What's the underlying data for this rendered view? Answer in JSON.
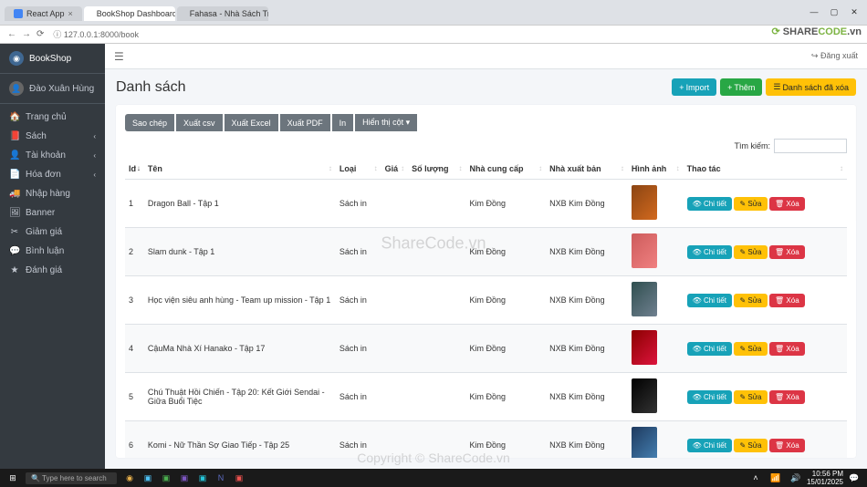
{
  "browser": {
    "tabs": [
      {
        "title": "React App",
        "active": false
      },
      {
        "title": "BookShop Dashboard",
        "active": true
      },
      {
        "title": "Fahasa - Nhà Sách Trực Tuyến",
        "active": false
      }
    ],
    "url": "127.0.0.1:8000/book"
  },
  "sidebar": {
    "brand": "BookShop",
    "user": "Đào Xuân Hùng",
    "items": [
      {
        "label": "Trang chủ",
        "icon": "🏠",
        "caret": false
      },
      {
        "label": "Sách",
        "icon": "📕",
        "caret": true
      },
      {
        "label": "Tài khoản",
        "icon": "👤",
        "caret": true
      },
      {
        "label": "Hóa đơn",
        "icon": "📄",
        "caret": true
      },
      {
        "label": "Nhập hàng",
        "icon": "🚚",
        "caret": false
      },
      {
        "label": "Banner",
        "icon": "🖼",
        "caret": false
      },
      {
        "label": "Giảm giá",
        "icon": "✂",
        "caret": false
      },
      {
        "label": "Bình luận",
        "icon": "💬",
        "caret": false
      },
      {
        "label": "Đánh giá",
        "icon": "★",
        "caret": false
      }
    ]
  },
  "topbar": {
    "logout": "Đăng xuất"
  },
  "page": {
    "title": "Danh sách",
    "actions": {
      "import": "Import",
      "add": "Thêm",
      "deleted_list": "Danh sách đã xóa"
    },
    "table_tools": {
      "copy": "Sao chép",
      "csv": "Xuất csv",
      "excel": "Xuất Excel",
      "pdf": "Xuất PDF",
      "print": "In",
      "columns": "Hiển thị cột"
    },
    "search_label": "Tìm kiếm:",
    "columns": {
      "id": "Id",
      "name": "Tên",
      "type": "Loại",
      "price": "Giá",
      "qty": "Số lượng",
      "supplier": "Nhà cung cấp",
      "publisher": "Nhà xuất bản",
      "image": "Hình ảnh",
      "actions": "Thao tác"
    },
    "action_labels": {
      "detail": "Chi tiết",
      "edit": "Sửa",
      "delete": "Xóa"
    },
    "rows": [
      {
        "id": "1",
        "name": "Dragon Ball - Tập 1",
        "type": "Sách in",
        "supplier": "Kim Đồng",
        "publisher": "NXB Kim Đồng",
        "img": "b1"
      },
      {
        "id": "2",
        "name": "Slam dunk - Tập 1",
        "type": "Sách in",
        "supplier": "Kim Đồng",
        "publisher": "NXB Kim Đồng",
        "img": "b2"
      },
      {
        "id": "3",
        "name": "Học viện siêu anh hùng - Team up mission - Tập 1",
        "type": "Sách in",
        "supplier": "Kim Đồng",
        "publisher": "NXB Kim Đồng",
        "img": "b3"
      },
      {
        "id": "4",
        "name": "CậuMa Nhà Xí Hanako - Tập 17",
        "type": "Sách in",
        "supplier": "Kim Đồng",
        "publisher": "NXB Kim Đồng",
        "img": "b4"
      },
      {
        "id": "5",
        "name": "Chú Thuật Hồi Chiến - Tập 20: Kết Giới Sendai - Giữa Buổi Tiệc",
        "type": "Sách in",
        "supplier": "Kim Đồng",
        "publisher": "NXB Kim Đồng",
        "img": "b5"
      },
      {
        "id": "6",
        "name": "Komi - Nữ Thần Sợ Giao Tiếp - Tập 25",
        "type": "Sách in",
        "supplier": "Kim Đồng",
        "publisher": "NXB Kim Đồng",
        "img": "b6"
      }
    ]
  },
  "watermark": {
    "logo": "SHARECODE.vn",
    "center": "ShareCode.vn",
    "copyright": "Copyright © ShareCode.vn"
  },
  "taskbar": {
    "search_placeholder": "Type here to search",
    "time": "10:56 PM",
    "date": "15/01/2025"
  }
}
